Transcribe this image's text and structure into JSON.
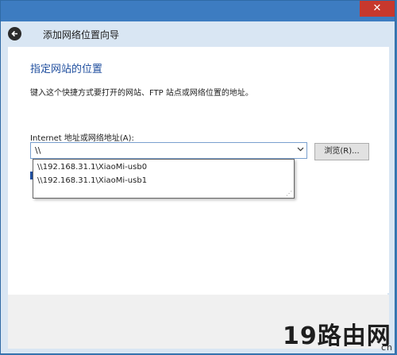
{
  "window": {
    "close_glyph": "✕",
    "wizard_title": "添加网络位置向导"
  },
  "page": {
    "heading": "指定网站的位置",
    "instruction": "键入这个快捷方式要打开的网站、FTP 站点或网络位置的地址。",
    "field_label": "Internet 地址或网络地址(A):",
    "address_value": "\\\\",
    "browse_label": "浏览(R)..."
  },
  "autocomplete": {
    "items": [
      "\\\\192.168.31.1\\XiaoMi-usb0",
      "\\\\192.168.31.1\\XiaoMi-usb1"
    ]
  },
  "watermark": {
    "logo_text": "19路由网",
    "sub_text": "cn"
  },
  "colors": {
    "frame": "#3d7cc1",
    "header_strip": "#d9e6f3",
    "heading": "#1f4e9e",
    "close": "#c7382d"
  }
}
